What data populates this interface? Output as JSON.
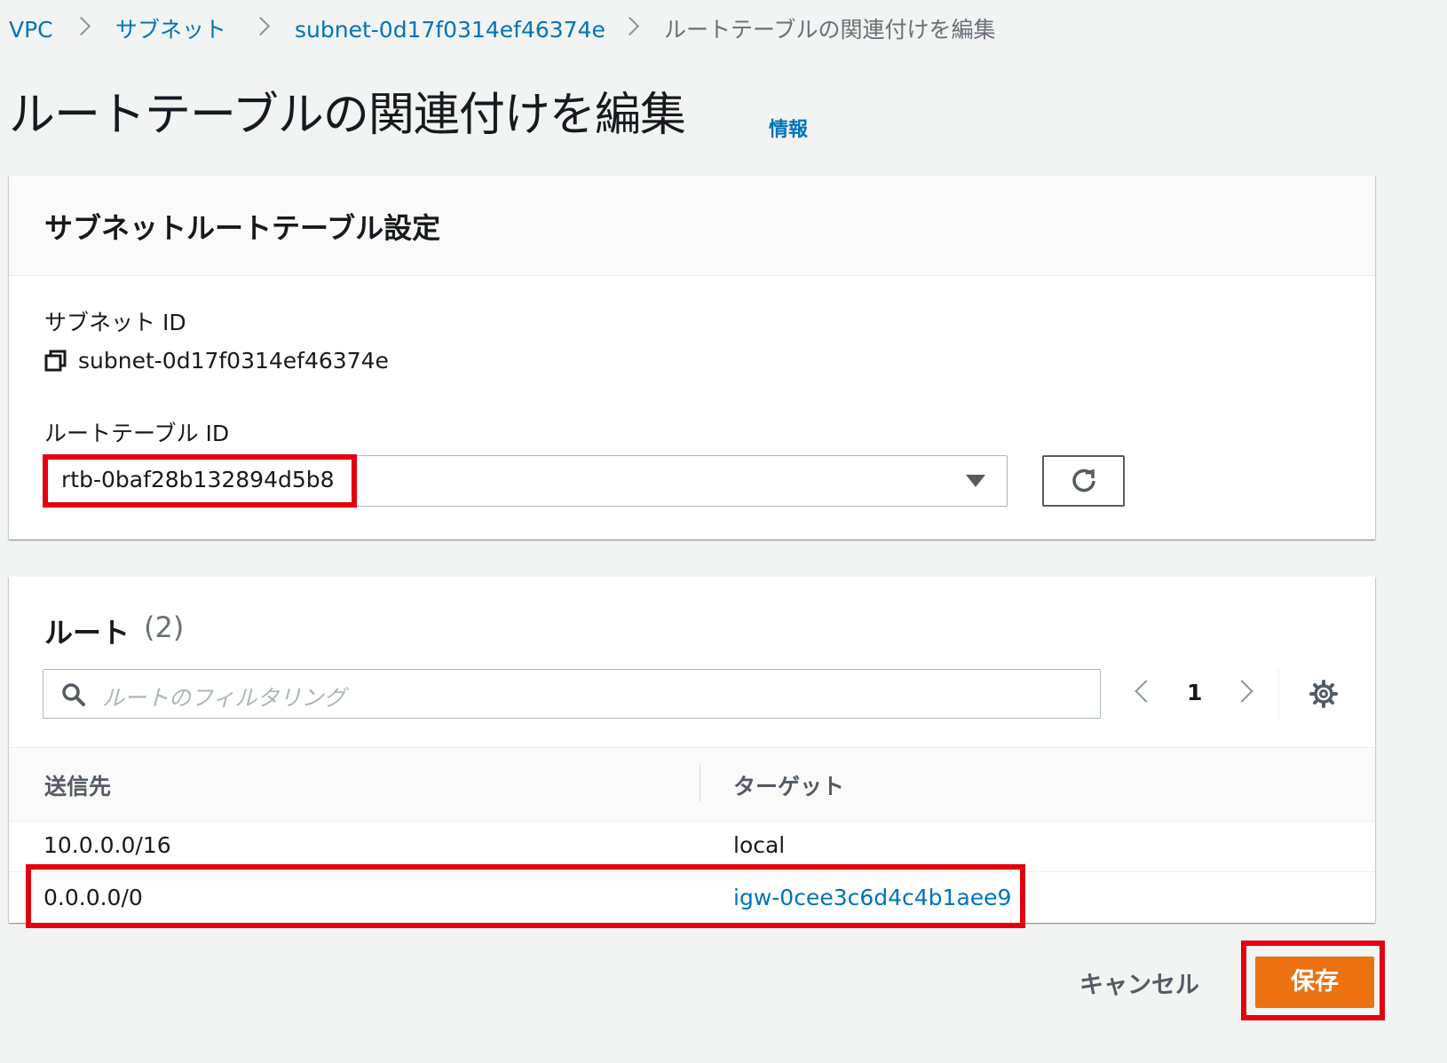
{
  "breadcrumb": {
    "vpc": "VPC",
    "subnets": "サブネット",
    "subnet": "subnet-0d17f0314ef46374e",
    "current": "ルートテーブルの関連付けを編集"
  },
  "page": {
    "title": "ルートテーブルの関連付けを編集",
    "info": "情報"
  },
  "settings": {
    "heading": "サブネットルートテーブル設定",
    "subnet_id_label": "サブネット ID",
    "subnet_id_value": "subnet-0d17f0314ef46374e",
    "route_table_id_label": "ルートテーブル ID",
    "route_table_selected": "rtb-0baf28b132894d5b8"
  },
  "routes": {
    "heading": "ルート",
    "count": "(2)",
    "filter_placeholder": "ルートのフィルタリング",
    "page_number": "1",
    "columns": {
      "destination": "送信先",
      "target": "ターゲット"
    },
    "rows": [
      {
        "destination": "10.0.0.0/16",
        "target": "local"
      },
      {
        "destination": "0.0.0.0/0",
        "target": "igw-0cee3c6d4c4b1aee9"
      }
    ]
  },
  "actions": {
    "cancel": "キャンセル",
    "save": "保存"
  },
  "colors": {
    "link": "#0073bb",
    "primary_button": "#ec7211",
    "highlight_box": "#e4000f",
    "page_background": "#f2f3f3"
  }
}
